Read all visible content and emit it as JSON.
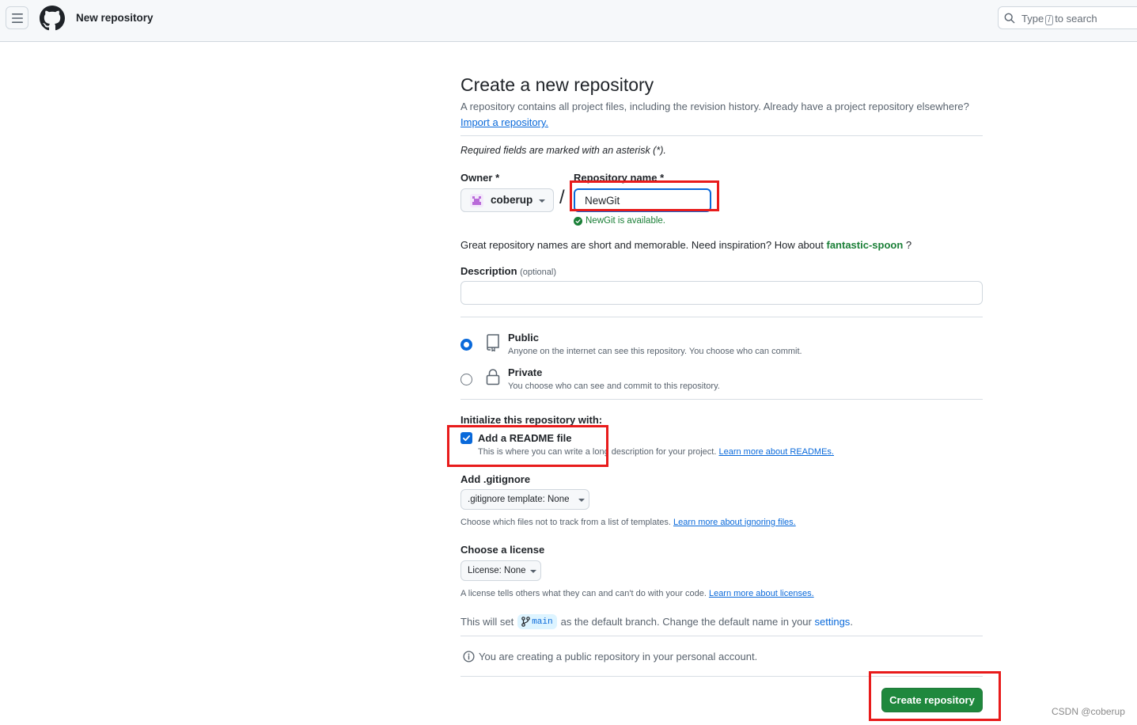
{
  "header": {
    "title": "New repository",
    "search_prefix": "Type",
    "search_key": "/",
    "search_suffix": "to search"
  },
  "page": {
    "title": "Create a new repository",
    "subtitle": "A repository contains all project files, including the revision history. Already have a project repository elsewhere?",
    "import_link": "Import a repository.",
    "required_note": "Required fields are marked with an asterisk (*)."
  },
  "form": {
    "owner_label": "Owner *",
    "owner_value": "coberup",
    "repo_name_label": "Repository name *",
    "repo_name_value": "NewGit",
    "slash": "/",
    "availability": "NewGit is available.",
    "inspiration_text": "Great repository names are short and memorable. Need inspiration? How about",
    "inspiration_suggestion": "fantastic-spoon",
    "inspiration_end": "?",
    "description_label": "Description",
    "description_optional": "(optional)",
    "description_value": ""
  },
  "visibility": {
    "selected": "Public",
    "public_title": "Public",
    "public_desc": "Anyone on the internet can see this repository. You choose who can commit.",
    "private_title": "Private",
    "private_desc": "You choose who can see and commit to this repository."
  },
  "init": {
    "label": "Initialize this repository with:",
    "readme_checked": true,
    "readme_title": "Add a README file",
    "readme_desc": "This is where you can write a long description for your project.",
    "readme_link": "Learn more about READMEs."
  },
  "gitignore": {
    "label": "Add .gitignore",
    "select_text": ".gitignore template: None",
    "note": "Choose which files not to track from a list of templates.",
    "link": "Learn more about ignoring files."
  },
  "license": {
    "label": "Choose a license",
    "select_text": "License: None",
    "note": "A license tells others what they can and can't do with your code.",
    "link": "Learn more about licenses."
  },
  "branch": {
    "prefix": "This will set",
    "branch_name": "main",
    "middle": "as the default branch. Change the default name in your",
    "settings_link": "settings",
    "suffix": "."
  },
  "info_note": "You are creating a public repository in your personal account.",
  "create_button": "Create repository",
  "watermark": "CSDN @coberup",
  "colors": {
    "accent": "#0969da",
    "success": "#1a7f37",
    "create_button": "#1f883d",
    "highlight_box": "#e81b1b"
  }
}
